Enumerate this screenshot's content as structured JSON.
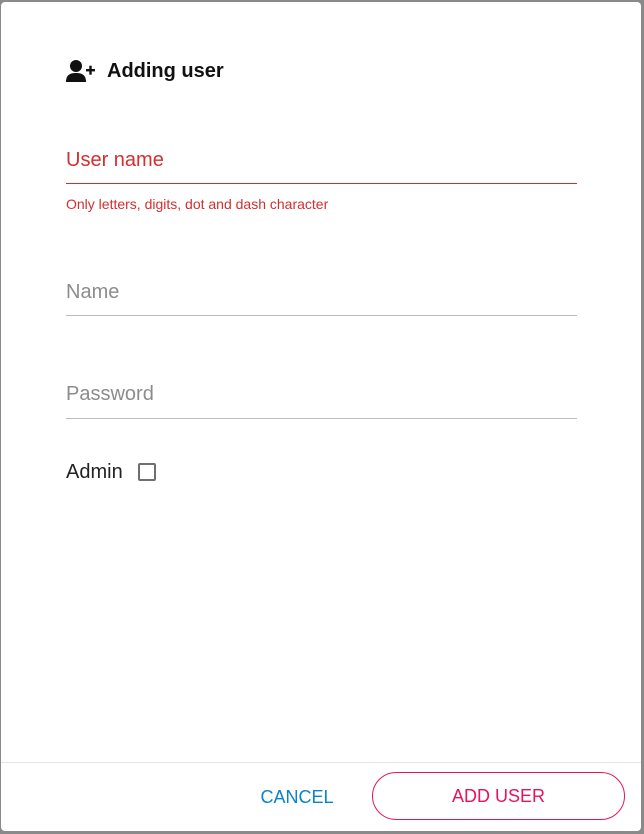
{
  "dialog": {
    "title": "Adding user",
    "title_icon": "user-plus-icon"
  },
  "fields": {
    "username": {
      "placeholder": "User name",
      "value": "",
      "error": "Only letters, digits, dot and dash character",
      "state": "error"
    },
    "name": {
      "placeholder": "Name",
      "value": ""
    },
    "password": {
      "placeholder": "Password",
      "value": ""
    }
  },
  "admin": {
    "label": "Admin",
    "checked": false
  },
  "actions": {
    "cancel_label": "CANCEL",
    "add_label": "ADD USER"
  },
  "colors": {
    "error": "#d32f2f",
    "cancel": "#0a83c8",
    "primary": "#e6145e",
    "underline": "#bdbdbd"
  }
}
